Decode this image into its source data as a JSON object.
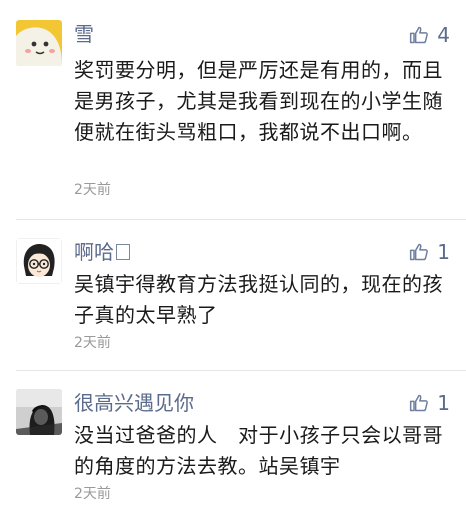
{
  "comments": [
    {
      "username": "雪",
      "like_count": "4",
      "text": "奖罚要分明，但是严厉还是有用的，而且是男孩子，尤其是我看到现在的小学生随便就在街头骂粗口，我都说不出口啊。",
      "time": "2天前",
      "avatar_icon": "cartoon-blob-avatar"
    },
    {
      "username": "啊哈",
      "username_suffix_glyph": "□",
      "like_count": "1",
      "text": "吴镇宇得教育方法我挺认同的，现在的孩子真的太早熟了",
      "time": "2天前",
      "avatar_icon": "glasses-girl-avatar"
    },
    {
      "username": "很高兴遇见你",
      "like_count": "1",
      "text": "没当过爸爸的人   对于小孩子只会以哥哥的角度的方法去教。站吴镇宇",
      "time": "2天前",
      "avatar_icon": "dark-photo-avatar"
    }
  ],
  "colors": {
    "username": "#5b6b8c",
    "body": "#1a1a1a",
    "time": "#9a9a9a",
    "like_icon": "#6f7f9f",
    "divider": "#e6e6e6"
  }
}
